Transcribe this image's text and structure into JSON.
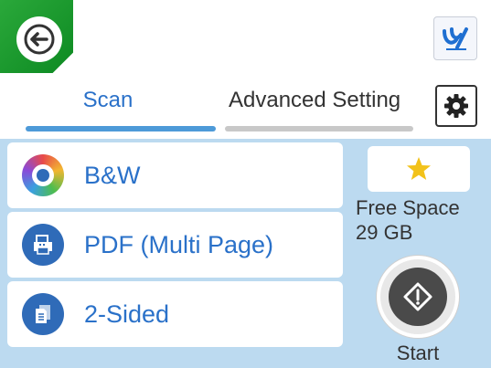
{
  "tabs": {
    "scan_label": "Scan",
    "advanced_label": "Advanced Setting"
  },
  "options": [
    {
      "label": "B&W",
      "icon": "color-mode-icon"
    },
    {
      "label": "PDF (Multi Page)",
      "icon": "file-format-icon"
    },
    {
      "label": "2-Sided",
      "icon": "two-sided-icon"
    }
  ],
  "storage": {
    "label": "Free Space",
    "value": "29 GB"
  },
  "start": {
    "label": "Start"
  },
  "colors": {
    "back_green": "#1a9a2a",
    "accent_blue": "#2a71c9",
    "panel_blue": "#bcdaf0",
    "star_yellow": "#f2c21a"
  }
}
